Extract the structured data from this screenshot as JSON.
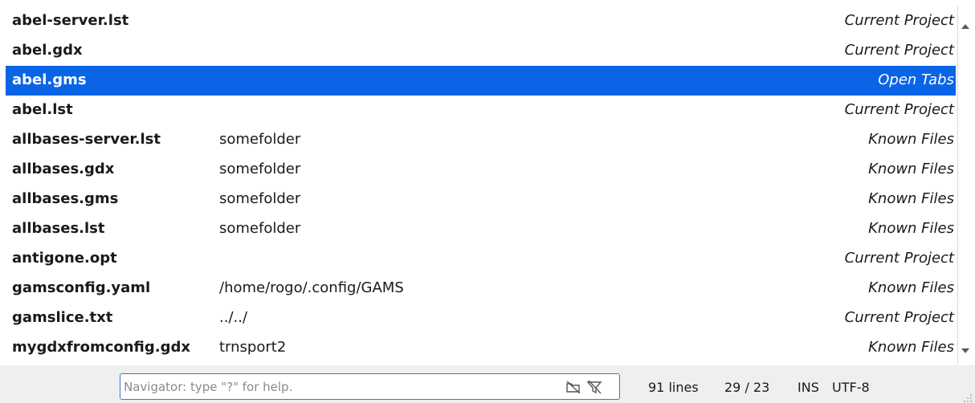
{
  "file_list": [
    {
      "name": "abel-server.lst",
      "path": "",
      "source": "Current Project",
      "selected": false
    },
    {
      "name": "abel.gdx",
      "path": "",
      "source": "Current Project",
      "selected": false
    },
    {
      "name": "abel.gms",
      "path": "",
      "source": "Open Tabs",
      "selected": true
    },
    {
      "name": "abel.lst",
      "path": "",
      "source": "Current Project",
      "selected": false
    },
    {
      "name": "allbases-server.lst",
      "path": "somefolder",
      "source": "Known Files",
      "selected": false
    },
    {
      "name": "allbases.gdx",
      "path": "somefolder",
      "source": "Known Files",
      "selected": false
    },
    {
      "name": "allbases.gms",
      "path": "somefolder",
      "source": "Known Files",
      "selected": false
    },
    {
      "name": "allbases.lst",
      "path": "somefolder",
      "source": "Known Files",
      "selected": false
    },
    {
      "name": "antigone.opt",
      "path": "",
      "source": "Current Project",
      "selected": false
    },
    {
      "name": "gamsconfig.yaml",
      "path": "/home/rogo/.config/GAMS",
      "source": "Known Files",
      "selected": false
    },
    {
      "name": "gamslice.txt",
      "path": "../../",
      "source": "Current Project",
      "selected": false
    },
    {
      "name": "mygdxfromconfig.gdx",
      "path": "trnsport2",
      "source": "Known Files",
      "selected": false
    }
  ],
  "navigator": {
    "placeholder": "Navigator: type \"?\" for help.",
    "value": "",
    "icons": [
      "folder-off-icon",
      "filter-off-icon"
    ]
  },
  "status": {
    "lines": "91 lines",
    "position": "29 / 23",
    "mode": "INS",
    "encoding": "UTF-8"
  },
  "colors": {
    "selection": "#0a64e6",
    "input_border": "#3a78c9",
    "statusbar_bg": "#efefef"
  }
}
